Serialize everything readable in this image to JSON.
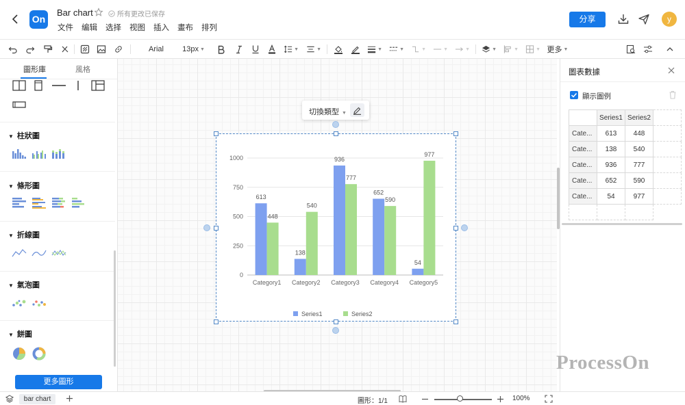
{
  "header": {
    "app_logo": "On",
    "title": "Bar chart",
    "save_status": "所有更改已保存",
    "menu": [
      "文件",
      "编辑",
      "选择",
      "视图",
      "插入",
      "畫布",
      "排列"
    ],
    "share_label": "分享",
    "avatar_letter": "y",
    "accent_color": "#1779e8"
  },
  "toolbar": {
    "font_family": "Arial",
    "font_size": "13px",
    "more_label": "更多"
  },
  "sidebar": {
    "tabs": [
      "圖形庫",
      "風格"
    ],
    "sections": [
      {
        "title": "柱狀圖"
      },
      {
        "title": "條形圖"
      },
      {
        "title": "折線圖"
      },
      {
        "title": "氣泡圖"
      },
      {
        "title": "餅圖"
      }
    ],
    "more_shapes_label": "更多圖形"
  },
  "canvas": {
    "switch_type_label": "切換類型"
  },
  "chart_data": {
    "type": "bar",
    "categories": [
      "Category1",
      "Category2",
      "Category3",
      "Category4",
      "Category5"
    ],
    "series": [
      {
        "name": "Series1",
        "values": [
          613,
          138,
          936,
          652,
          54
        ],
        "color": "#7ea0ef"
      },
      {
        "name": "Series2",
        "values": [
          448,
          540,
          777,
          590,
          977
        ],
        "color": "#a8dd8e"
      }
    ],
    "ylim": [
      0,
      1000
    ],
    "yticks": [
      0,
      250,
      500,
      750,
      1000
    ],
    "grid": true,
    "legend": "bottom"
  },
  "right_panel": {
    "title": "圖表數據",
    "show_legend_label": "顯示圖例",
    "columns": [
      "Series1",
      "Series2"
    ],
    "rows": [
      {
        "label": "Cate...",
        "values": [
          "613",
          "448"
        ]
      },
      {
        "label": "Cate...",
        "values": [
          "138",
          "540"
        ]
      },
      {
        "label": "Cate...",
        "values": [
          "936",
          "777"
        ]
      },
      {
        "label": "Cate...",
        "values": [
          "652",
          "590"
        ]
      },
      {
        "label": "Cate...",
        "values": [
          "54",
          "977"
        ]
      }
    ]
  },
  "watermark": "ProcessOn",
  "statusbar": {
    "page_tab": "bar chart",
    "shape_count": "圖形：1/1",
    "zoom": "100%"
  }
}
